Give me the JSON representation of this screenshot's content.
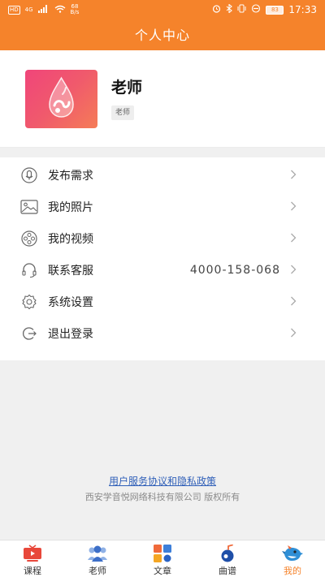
{
  "status_bar": {
    "left_badge": "HD",
    "network": "4G",
    "speed_value": "68",
    "speed_unit": "B/s",
    "battery": "83",
    "time": "17:33"
  },
  "header": {
    "title": "个人中心"
  },
  "profile": {
    "name": "老师",
    "tag": "老师"
  },
  "menu": {
    "items": [
      {
        "label": "发布需求",
        "icon": "microphone-icon"
      },
      {
        "label": "我的照片",
        "icon": "image-icon"
      },
      {
        "label": "我的视频",
        "icon": "video-reel-icon"
      },
      {
        "label": "联系客服",
        "icon": "headset-icon",
        "value": "4000-158-068"
      },
      {
        "label": "系统设置",
        "icon": "gear-icon"
      },
      {
        "label": "退出登录",
        "icon": "logout-icon"
      }
    ]
  },
  "footer": {
    "policy_link": "用户服务协议和隐私政策",
    "copyright": "西安学音悦网络科技有限公司 版权所有"
  },
  "bottom_nav": {
    "items": [
      {
        "label": "课程",
        "icon": "course-tv-icon"
      },
      {
        "label": "老师",
        "icon": "teachers-icon"
      },
      {
        "label": "文章",
        "icon": "article-grid-icon"
      },
      {
        "label": "曲谱",
        "icon": "music-note-icon"
      },
      {
        "label": "我的",
        "icon": "bird-mascot-icon"
      }
    ],
    "active_index": 4
  },
  "colors": {
    "brand_orange": "#f5832b",
    "link_blue": "#2f5fb8"
  }
}
